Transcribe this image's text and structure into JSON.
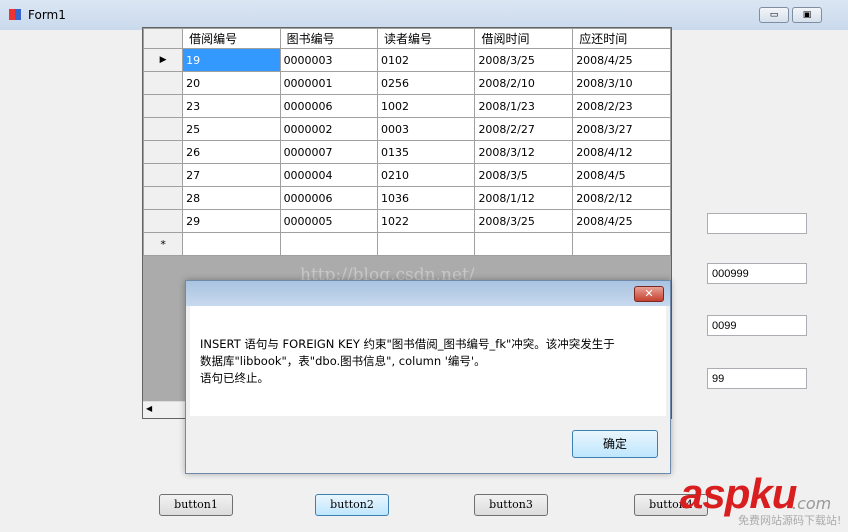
{
  "window": {
    "title": "Form1",
    "min": "▭",
    "max": "▣",
    "close": "✕"
  },
  "grid": {
    "columns": [
      "借阅编号",
      "图书编号",
      "读者编号",
      "借阅时间",
      "应还时间"
    ],
    "rows": [
      [
        "19",
        "0000003",
        "0102",
        "2008/3/25",
        "2008/4/25"
      ],
      [
        "20",
        "0000001",
        "0256",
        "2008/2/10",
        "2008/3/10"
      ],
      [
        "23",
        "0000006",
        "1002",
        "2008/1/23",
        "2008/2/23"
      ],
      [
        "25",
        "0000002",
        "0003",
        "2008/2/27",
        "2008/3/27"
      ],
      [
        "26",
        "0000007",
        "0135",
        "2008/3/12",
        "2008/4/12"
      ],
      [
        "27",
        "0000004",
        "0210",
        "2008/3/5",
        "2008/4/5"
      ],
      [
        "28",
        "0000006",
        "1036",
        "2008/1/12",
        "2008/2/12"
      ],
      [
        "29",
        "0000005",
        "1022",
        "2008/3/25",
        "2008/4/25"
      ]
    ],
    "current_marker": "▶",
    "new_row_marker": "*"
  },
  "textboxes": [
    "",
    "000999",
    "0099",
    "99"
  ],
  "buttons": [
    "button1",
    "button2",
    "button3",
    "button4"
  ],
  "dialog": {
    "line1": "INSERT 语句与 FOREIGN KEY 约束\"图书借阅_图书编号_fk\"冲突。该冲突发生于",
    "line2": "数据库\"libbook\"，表\"dbo.图书信息\", column '编号'。",
    "line3": "语句已终止。",
    "ok": "确定",
    "close": "✕"
  },
  "watermark": "http://blog.csdn.net/",
  "logo": {
    "main": "aspku",
    ".com": ".com",
    "slogan": "免费网站源码下载站!"
  }
}
